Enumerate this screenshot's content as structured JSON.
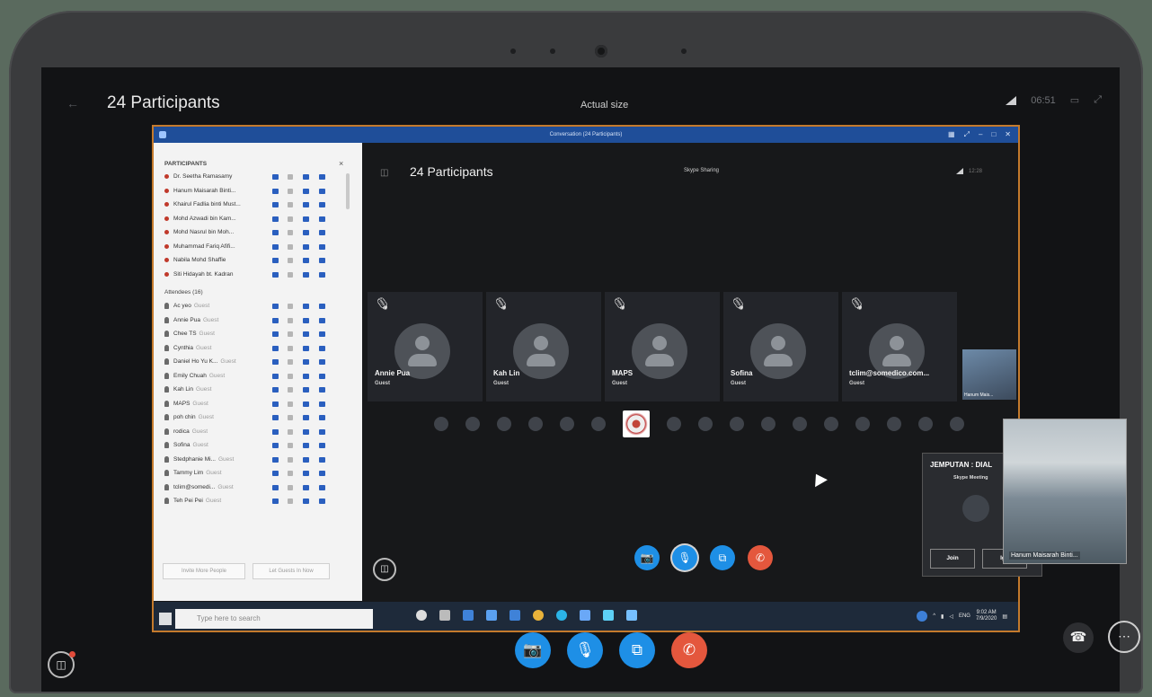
{
  "outer": {
    "title": "24 Participants",
    "center_label": "Actual size",
    "clock": "06:51"
  },
  "window": {
    "title": "Conversation (24 Participants)"
  },
  "pane": {
    "header": "PARTICIPANTS",
    "close": "×",
    "presenters": [
      "Dr. Seetha Ramasamy",
      "Hanum Maisarah Binti...",
      "Khairul Fadlia binti Must...",
      "Mohd Azwadi bin Kam...",
      "Mohd Nasrul bin Moh...",
      "Muhammad Fariq Afifi...",
      "Nabila Mohd Shaffie",
      "Siti Hidayah bt. Kadran"
    ],
    "attendees_label": "Attendees (16)",
    "attendees": [
      {
        "name": "Ac yeo",
        "role": "Guest"
      },
      {
        "name": "Annie Pua",
        "role": "Guest"
      },
      {
        "name": "Chee TS",
        "role": "Guest"
      },
      {
        "name": "Cynthia",
        "role": "Guest"
      },
      {
        "name": "Daniel Ho Yu K...",
        "role": "Guest"
      },
      {
        "name": "Emily Chuah",
        "role": "Guest"
      },
      {
        "name": "Kah Lin",
        "role": "Guest"
      },
      {
        "name": "MAPS",
        "role": "Guest"
      },
      {
        "name": "poh chin",
        "role": "Guest"
      },
      {
        "name": "rodica",
        "role": "Guest"
      },
      {
        "name": "Sofina",
        "role": "Guest"
      },
      {
        "name": "Stedphanie Mi...",
        "role": "Guest"
      },
      {
        "name": "Tammy Lim",
        "role": "Guest"
      },
      {
        "name": "tclim@somedi...",
        "role": "Guest"
      },
      {
        "name": "Teh Pei Pei",
        "role": "Guest"
      }
    ],
    "invite_button": "Invite More People",
    "lobby_button": "Let Guests In Now"
  },
  "stage": {
    "title": "24 Participants",
    "sharing": "Skype Sharing",
    "clock": "12:28",
    "tiles": [
      {
        "name": "Annie Pua",
        "role": "Guest"
      },
      {
        "name": "Kah Lin",
        "role": "Guest"
      },
      {
        "name": "MAPS",
        "role": "Guest"
      },
      {
        "name": "Sofina",
        "role": "Guest"
      },
      {
        "name": "tclim@somedico.com...",
        "role": "Guest"
      }
    ],
    "side_thumb_label": "Hanum Mais..."
  },
  "taskbar": {
    "search_placeholder": "Type here to search",
    "lang": "ENG",
    "time": "9:02 AM",
    "date": "7/9/2020"
  },
  "popup": {
    "title": "JEMPUTAN : DIAL",
    "subtitle": "Skype Meeting",
    "join": "Join",
    "ignore": "Ign"
  },
  "pip": {
    "name": "Hanum Maisarah Binti..."
  },
  "icons": {
    "mute": "🎙",
    "camera": "📷",
    "share": "⧉",
    "hangup": "✆",
    "chat": "💬",
    "phone": "☎",
    "more": "⋯"
  }
}
